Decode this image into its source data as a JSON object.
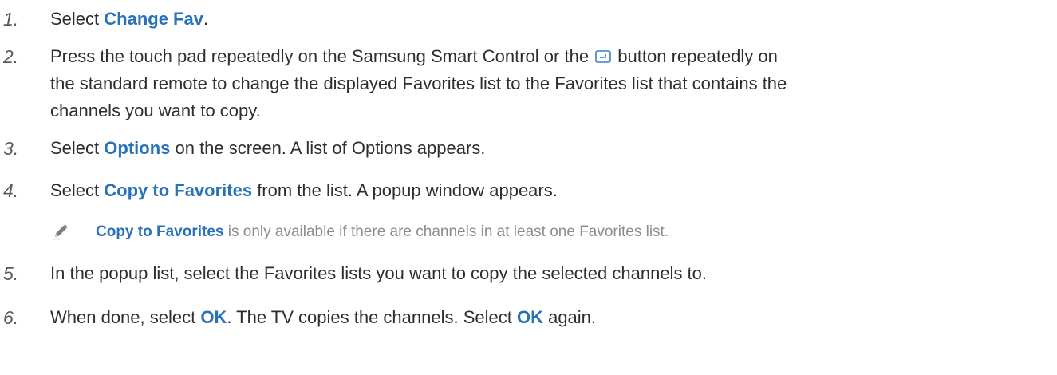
{
  "steps": [
    {
      "number": "1.",
      "parts": [
        "Select ",
        "Change Fav",
        "."
      ]
    },
    {
      "number": "2.",
      "line1_before": "Press the touch pad repeatedly on the Samsung Smart Control or the ",
      "line1_after": " button repeatedly on",
      "line2": "the standard remote to change the displayed Favorites list to the Favorites list that contains the",
      "line3": "channels you want to copy."
    },
    {
      "number": "3.",
      "parts": [
        "Select ",
        "Options",
        " on the screen. A list of Options appears."
      ]
    },
    {
      "number": "4.",
      "parts": [
        "Select ",
        "Copy to Favorites",
        " from the list. A popup window appears."
      ]
    },
    {
      "number": "5.",
      "text": "In the popup list, select the Favorites lists you want to copy the selected channels to."
    },
    {
      "number": "6.",
      "parts": [
        "When done, select ",
        "OK",
        ". The TV copies the channels. Select ",
        "OK",
        " again."
      ]
    }
  ],
  "note": {
    "icon": "pencil-icon",
    "keyword": "Copy to Favorites",
    "text": " is only available if there are channels in at least one Favorites list."
  },
  "inline_icon": "remote-button-icon",
  "colors": {
    "keyword": "#2a72b8",
    "body_text": "#2e2e2e",
    "note_text": "#8c8c8c"
  }
}
